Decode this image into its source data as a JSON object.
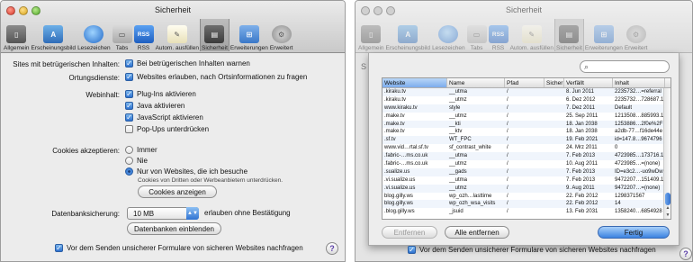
{
  "left_window": {
    "title": "Sicherheit",
    "toolbar": [
      {
        "label": "Allgemein",
        "icon": "general-icon"
      },
      {
        "label": "Erscheinungsbild",
        "icon": "appearance-icon"
      },
      {
        "label": "Lesezeichen",
        "icon": "bookmarks-icon"
      },
      {
        "label": "Tabs",
        "icon": "tabs-icon"
      },
      {
        "label": "RSS",
        "icon": "rss-icon"
      },
      {
        "label": "Autom. ausfüllen",
        "icon": "autofill-icon"
      },
      {
        "label": "Sicherheit",
        "icon": "security-icon",
        "selected": true
      },
      {
        "label": "Erweiterungen",
        "icon": "extensions-icon"
      },
      {
        "label": "Erweitert",
        "icon": "advanced-gear-icon"
      }
    ],
    "fraud_label": "Sites mit betrügerischen Inhalten:",
    "fraud_warn": "Bei betrügerischen Inhalten warnen",
    "location_label": "Ortungsdienste:",
    "location_allow": "Websites erlauben, nach Ortsinformationen zu fragen",
    "webcontent_label": "Webinhalt:",
    "plugins": "Plug-Ins aktivieren",
    "java": "Java aktivieren",
    "javascript": "JavaScript aktivieren",
    "popups": "Pop-Ups unterdrücken",
    "cookies_label": "Cookies akzeptieren:",
    "cookies_always": "Immer",
    "cookies_never": "Nie",
    "cookies_visited": "Nur von Websites, die ich besuche",
    "cookies_note": "Cookies von Dritten oder Werbeanbietern unterdrücken.",
    "show_cookies": "Cookies anzeigen",
    "db_label": "Datenbanksicherung:",
    "db_size": "10 MB",
    "db_allow": "erlauben ohne Bestätigung",
    "show_db": "Datenbanken einblenden",
    "forms_warn": "Vor dem Senden unsicherer Formulare von sicheren Websites nachfragen"
  },
  "right_window": {
    "title": "Sicherheit",
    "ghost_letter": "S",
    "columns": [
      "Website",
      "Name",
      "Pfad",
      "Sicher",
      "Verfällt",
      "Inhalt"
    ],
    "rows": [
      [
        ".kiraku.tv",
        "__utma",
        "/",
        "",
        "8. Jun 2011",
        "2235732…=referral"
      ],
      [
        ".kiraku.tv",
        "__utmz",
        "/",
        "",
        "6. Dez 2012",
        "2235732…728687.1"
      ],
      [
        "www.kiraku.tv",
        "style",
        "/",
        "",
        "7. Dez 2011",
        "Default"
      ],
      [
        ".make.tv",
        "__utmz",
        "/",
        "",
        "25. Sep 2011",
        "1213508…885993.1"
      ],
      [
        ".make.tv",
        "__kti",
        "/",
        "",
        "18. Jan 2038",
        "1253886…2f0e%2F"
      ],
      [
        ".make.tv",
        "__ktv",
        "/",
        "",
        "18. Jan 2038",
        "a2db-77…f16de44e"
      ],
      [
        ".sf.tv",
        "WT_FPC",
        "/",
        "",
        "19. Feb 2021",
        "id=147.8…9674796"
      ],
      [
        "www.vid…rtal.sf.tv",
        "sf_contrast_white",
        "/",
        "",
        "24. Mrz 2011",
        "0"
      ],
      [
        ".fabric-…ms.co.uk",
        "__utma",
        "/",
        "",
        "7. Feb 2013",
        "4723985…173716.1"
      ],
      [
        ".fabric-…ms.co.uk",
        "__utmz",
        "/",
        "",
        "10. Aug 2011",
        "4723985…=(none)"
      ],
      [
        ".sualize.us",
        "__gads",
        "/",
        "",
        "7. Feb 2013",
        "ID=e3c2…-uo9wDw"
      ],
      [
        ".vi.sualize.us",
        "__utma",
        "/",
        "",
        "7. Feb 2013",
        "9472207…151409.1"
      ],
      [
        ".vi.sualize.us",
        "__utmz",
        "/",
        "",
        "9. Aug 2011",
        "9472207…=(none)"
      ],
      [
        "blog.gilly.ws",
        "wp_ozh…lasttime",
        "/",
        "",
        "22. Feb 2012",
        "1298371567"
      ],
      [
        "blog.gilly.ws",
        "wp_ozh_wsa_visits",
        "/",
        "",
        "22. Feb 2012",
        "14"
      ],
      [
        ".blog.gilly.ws",
        "_jsuid",
        "/",
        "",
        "13. Feb 2031",
        "1358240…6854928"
      ]
    ],
    "remove": "Entfernen",
    "remove_all": "Alle entfernen",
    "done": "Fertig",
    "forms_warn": "Vor dem Senden unsicherer Formulare von sicheren Websites nachfragen"
  }
}
